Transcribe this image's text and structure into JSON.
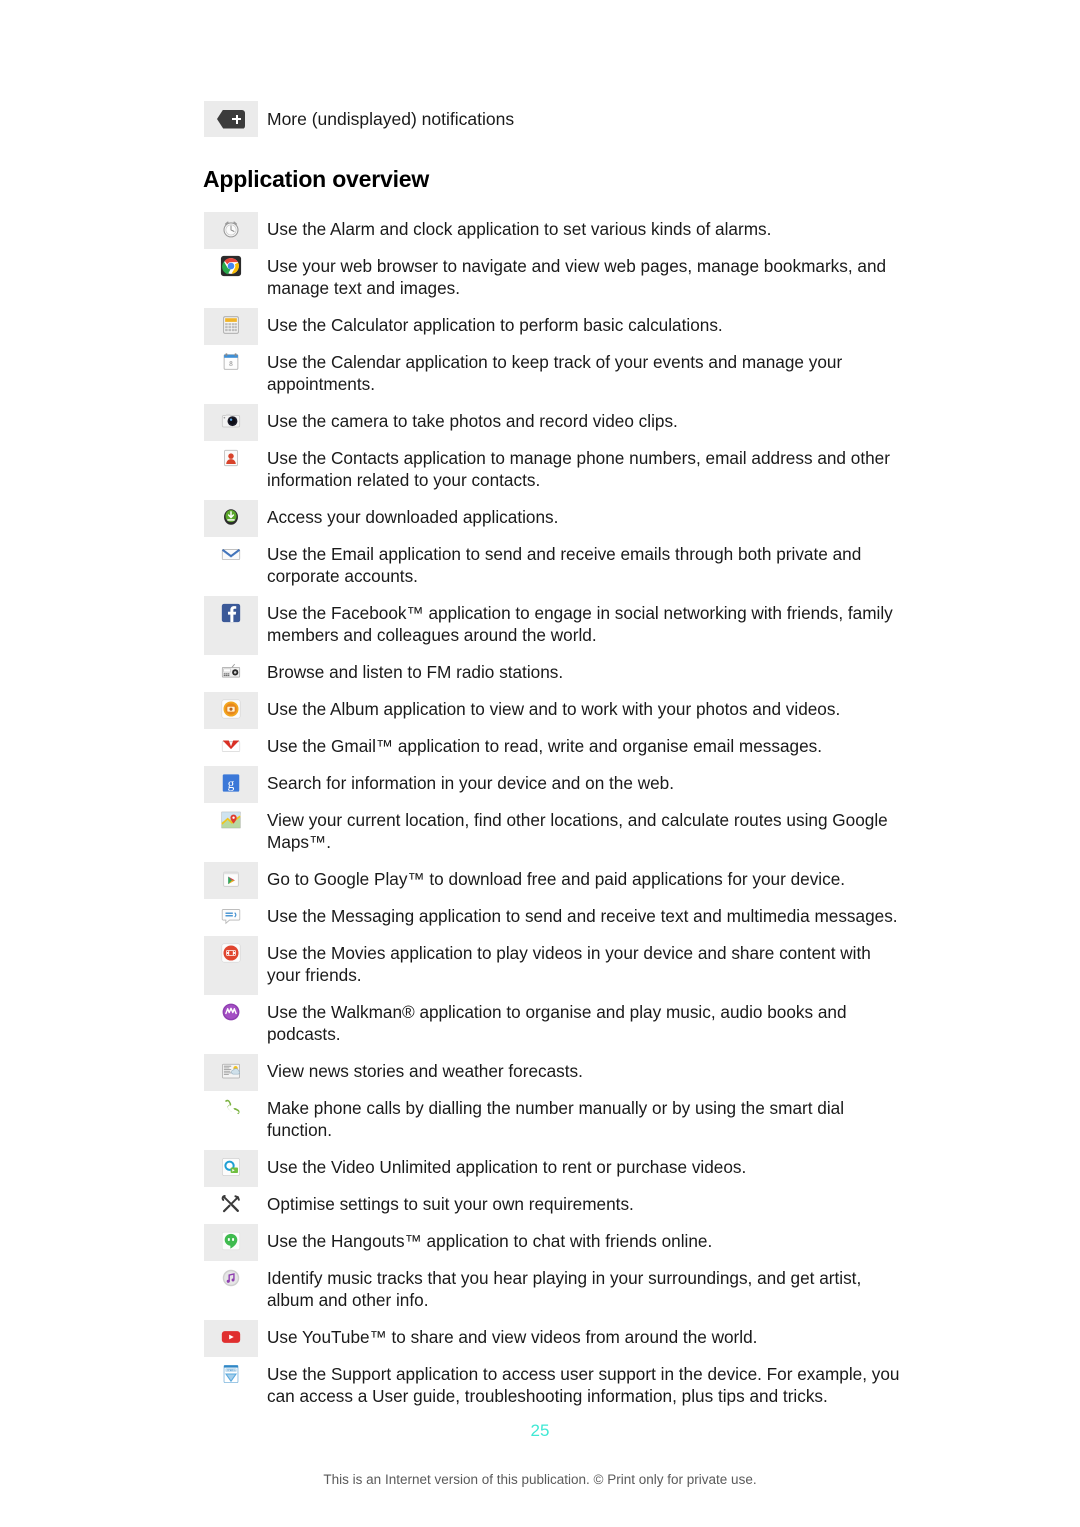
{
  "notification": {
    "icon": "more-notifications-icon",
    "label": "More (undisplayed) notifications"
  },
  "heading": "Application overview",
  "colors": {
    "page_number": "#3fe8d4",
    "shaded_cell": "#ebebeb",
    "body_text": "#1a1a1a",
    "footnote": "#5a5a5a"
  },
  "apps": [
    {
      "icon": "alarm-clock-icon",
      "shaded": true,
      "desc": "Use the Alarm and clock application to set various kinds of alarms."
    },
    {
      "icon": "chrome-browser-icon",
      "shaded": false,
      "desc": "Use your web browser to navigate and view web pages, manage bookmarks, and manage text and images."
    },
    {
      "icon": "calculator-icon",
      "shaded": true,
      "desc": "Use the Calculator application to perform basic calculations."
    },
    {
      "icon": "calendar-icon",
      "shaded": false,
      "desc": "Use the Calendar application to keep track of your events and manage your appointments."
    },
    {
      "icon": "camera-icon",
      "shaded": true,
      "desc": "Use the camera to take photos and record video clips."
    },
    {
      "icon": "contacts-icon",
      "shaded": false,
      "desc": "Use the Contacts application to manage phone numbers, email address and other information related to your contacts."
    },
    {
      "icon": "downloads-icon",
      "shaded": true,
      "desc": "Access your downloaded applications."
    },
    {
      "icon": "email-icon",
      "shaded": false,
      "desc": "Use the Email application to send and receive emails through both private and corporate accounts."
    },
    {
      "icon": "facebook-icon",
      "shaded": true,
      "desc": "Use the Facebook™ application to engage in social networking with friends, family members and colleagues around the world."
    },
    {
      "icon": "fm-radio-icon",
      "shaded": false,
      "desc": "Browse and listen to FM radio stations."
    },
    {
      "icon": "album-icon",
      "shaded": true,
      "desc": "Use the Album application to view and to work with your photos and videos."
    },
    {
      "icon": "gmail-icon",
      "shaded": false,
      "desc": "Use the Gmail™ application to read, write and organise email messages."
    },
    {
      "icon": "google-search-icon",
      "shaded": true,
      "desc": "Search for information in your device and on the web."
    },
    {
      "icon": "google-maps-icon",
      "shaded": false,
      "desc": "View your current location, find other locations, and calculate routes using Google Maps™."
    },
    {
      "icon": "google-play-icon",
      "shaded": true,
      "desc": "Go to Google Play™ to download free and paid applications for your device."
    },
    {
      "icon": "messaging-icon",
      "shaded": false,
      "desc": "Use the Messaging application to send and receive text and multimedia messages."
    },
    {
      "icon": "movies-icon",
      "shaded": true,
      "desc": "Use the Movies application to play videos in your device and share content with your friends."
    },
    {
      "icon": "walkman-icon",
      "shaded": false,
      "desc": "Use the Walkman® application to organise and play music, audio books and podcasts."
    },
    {
      "icon": "news-weather-icon",
      "shaded": true,
      "desc": "View news stories and weather forecasts."
    },
    {
      "icon": "phone-icon",
      "shaded": false,
      "desc": "Make phone calls by dialling the number manually or by using the smart dial function."
    },
    {
      "icon": "video-unlimited-icon",
      "shaded": true,
      "desc": "Use the Video Unlimited application to rent or purchase videos."
    },
    {
      "icon": "settings-icon",
      "shaded": false,
      "desc": "Optimise settings to suit your own requirements."
    },
    {
      "icon": "hangouts-icon",
      "shaded": true,
      "desc": "Use the Hangouts™ application to chat with friends online."
    },
    {
      "icon": "trackid-icon",
      "shaded": false,
      "desc": "Identify music tracks that you hear playing in your surroundings, and get artist, album and other info."
    },
    {
      "icon": "youtube-icon",
      "shaded": true,
      "desc": "Use YouTube™ to share and view videos from around the world."
    },
    {
      "icon": "support-icon",
      "shaded": false,
      "desc": "Use the Support application to access user support in the device. For example, you can access a User guide, troubleshooting information, plus tips and tricks."
    }
  ],
  "footer": {
    "page_number": "25",
    "note": "This is an Internet version of this publication. © Print only for private use."
  }
}
